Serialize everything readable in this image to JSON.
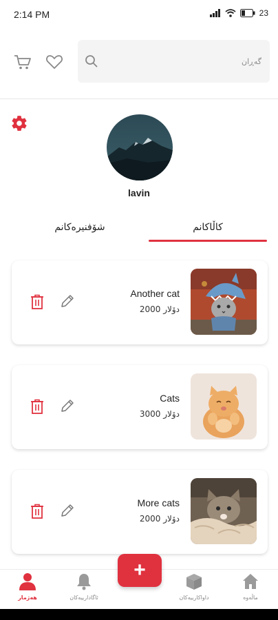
{
  "status_bar": {
    "time": "2:14 PM",
    "battery": "23"
  },
  "header": {
    "search_placeholder": "گەڕان",
    "icons": [
      "cart-icon",
      "heart-icon",
      "search-icon"
    ]
  },
  "profile": {
    "username": "lavin",
    "icons": [
      "settings-icon"
    ]
  },
  "tabs": [
    {
      "label": "کاڵاکانم",
      "active": true
    },
    {
      "label": "شۆفنیرەکانم",
      "active": false
    }
  ],
  "products": [
    {
      "title": "Another cat",
      "price": "2000 دۆلار"
    },
    {
      "title": "Cats",
      "price": "3000 دۆلار"
    },
    {
      "title": "More cats",
      "price": "2000 دۆلار"
    }
  ],
  "bottom_nav": {
    "items": [
      {
        "label": "هەژمار",
        "icon": "person-icon",
        "active": true
      },
      {
        "label": "ئاگادارییەکان",
        "icon": "bell-icon",
        "active": false
      },
      {
        "label": "داواکارییەکان",
        "icon": "box-icon",
        "active": false
      },
      {
        "label": "ماڵەوە",
        "icon": "home-icon",
        "active": false
      }
    ],
    "fab_label": "+"
  },
  "colors": {
    "accent": "#e0313f",
    "muted": "#8a8a8a"
  }
}
